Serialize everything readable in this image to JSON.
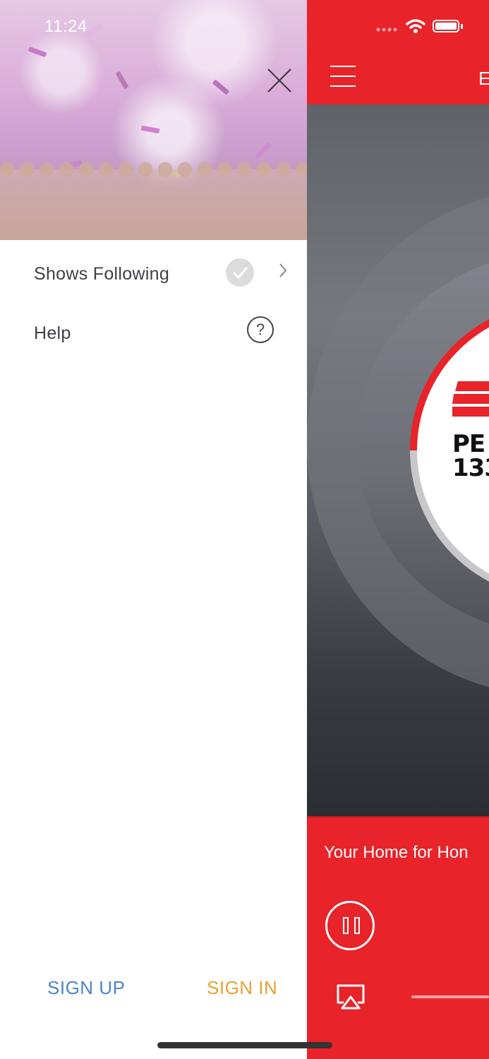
{
  "status_bar": {
    "time": "11:24"
  },
  "drawer": {
    "menu": [
      {
        "label": "Shows Following",
        "icon": "check-circle-icon",
        "trailing": "chevron-right-icon"
      },
      {
        "label": "Help",
        "icon": "question-circle-icon"
      }
    ],
    "sign_up_label": "SIGN UP",
    "sign_in_label": "SIGN IN",
    "help_glyph": "?"
  },
  "main": {
    "title": "E",
    "logo_line1": "PE",
    "logo_line2": "133",
    "now_playing": "Your Home for Hon"
  },
  "colors": {
    "brand_red": "#e8232a",
    "sign_up": "#4a86c8",
    "sign_in": "#e8a131"
  }
}
